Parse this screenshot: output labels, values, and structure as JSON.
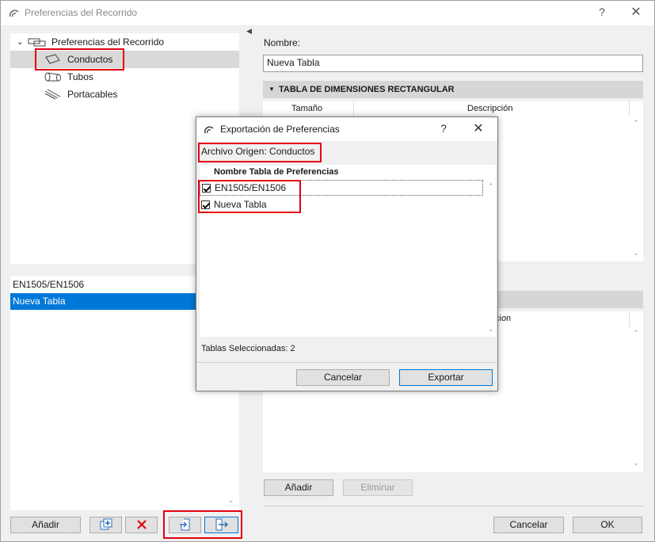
{
  "window": {
    "title": "Preferencias del Recorrido",
    "help": "?",
    "close": "✕"
  },
  "tree": {
    "root": "Preferencias del Recorrido",
    "items": [
      {
        "label": "Conductos",
        "icon": "duct-icon"
      },
      {
        "label": "Tubos",
        "icon": "pipe-icon"
      },
      {
        "label": "Portacables",
        "icon": "cable-tray-icon"
      }
    ]
  },
  "tables_list": {
    "items": [
      "EN1505/EN1506",
      "Nueva Tabla"
    ],
    "selected": "Nueva Tabla"
  },
  "left_buttons": {
    "add": "Añadir"
  },
  "right": {
    "name_label": "Nombre:",
    "name_value": "Nueva Tabla",
    "section1": "TABLA DE DIMENSIONES RECTANGULAR",
    "col_size": "Tamaño",
    "col_desc": "Descripción",
    "col_desc_partial": "cion",
    "add": "Añadir",
    "delete": "Eliminar"
  },
  "footer": {
    "cancel": "Cancelar",
    "ok": "OK"
  },
  "dialog": {
    "title": "Exportación de Preferencias",
    "help": "?",
    "close": "✕",
    "source": "Archivo Origen: Conductos",
    "list_header": "Nombre Tabla de Preferencias",
    "rows": [
      {
        "label": "EN1505/EN1506",
        "checked": true
      },
      {
        "label": "Nueva Tabla",
        "checked": true
      }
    ],
    "status": "Tablas Seleccionadas: 2",
    "cancel": "Cancelar",
    "export": "Exportar"
  },
  "colors": {
    "selection": "#0078d7",
    "highlight_box": "#e3000f"
  }
}
